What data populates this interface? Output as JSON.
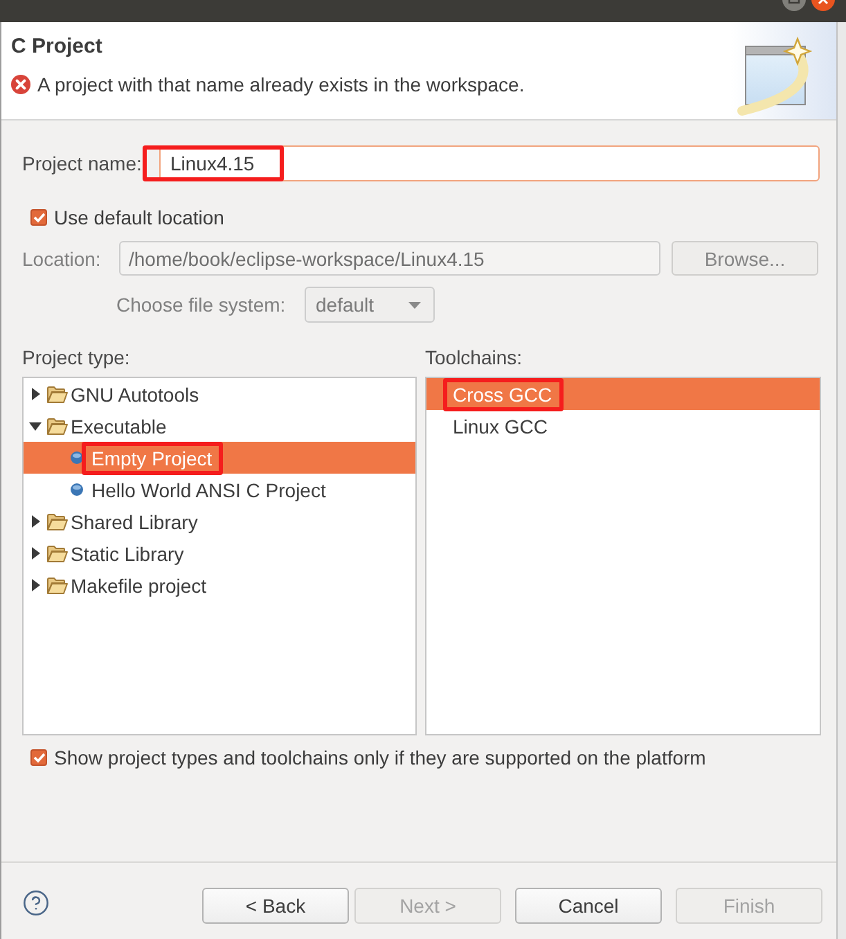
{
  "window_controls": [
    {
      "kind": "maximize"
    },
    {
      "kind": "close"
    }
  ],
  "wizard_page": {
    "title": "C Project",
    "message": {
      "kind": "error",
      "text": "A project with that name already exists in the workspace."
    }
  },
  "project_name": {
    "label": "Project name:",
    "value": "Linux4.15",
    "focused": true,
    "annotated": true
  },
  "use_default_location": {
    "label": "Use default location",
    "checked": true
  },
  "location": {
    "label": "Location:",
    "value": "/home/book/eclipse-workspace/Linux4.15",
    "disabled": true,
    "browse_button": {
      "label": "Browse...",
      "disabled": true
    }
  },
  "file_system": {
    "label": "Choose file system:",
    "value": "default",
    "disabled": true
  },
  "project_type": {
    "label": "Project type:",
    "tree": [
      {
        "label": "GNU Autotools",
        "kind": "folder",
        "expanded": false,
        "selected": false,
        "annotated": false
      },
      {
        "label": "Executable",
        "kind": "folder",
        "expanded": true,
        "selected": false,
        "annotated": false,
        "children": [
          {
            "label": "Empty Project",
            "kind": "project",
            "selected": true,
            "annotated": true
          },
          {
            "label": "Hello World ANSI C Project",
            "kind": "project",
            "selected": false,
            "annotated": false
          }
        ]
      },
      {
        "label": "Shared Library",
        "kind": "folder",
        "expanded": false,
        "selected": false,
        "annotated": false
      },
      {
        "label": "Static Library",
        "kind": "folder",
        "expanded": false,
        "selected": false,
        "annotated": false
      },
      {
        "label": "Makefile project",
        "kind": "folder",
        "expanded": false,
        "selected": false,
        "annotated": false
      }
    ]
  },
  "toolchains": {
    "label": "Toolchains:",
    "items": [
      {
        "label": "Cross GCC",
        "selected": true,
        "annotated": true
      },
      {
        "label": "Linux GCC",
        "selected": false,
        "annotated": false
      }
    ]
  },
  "show_supported_only": {
    "label": "Show project types and toolchains only if they are supported on the platform",
    "checked": true
  },
  "buttons": [
    {
      "label": "< Back",
      "disabled": false
    },
    {
      "label": "Next >",
      "disabled": true
    },
    {
      "label": "Cancel",
      "disabled": false
    },
    {
      "label": "Finish",
      "disabled": true
    }
  ]
}
